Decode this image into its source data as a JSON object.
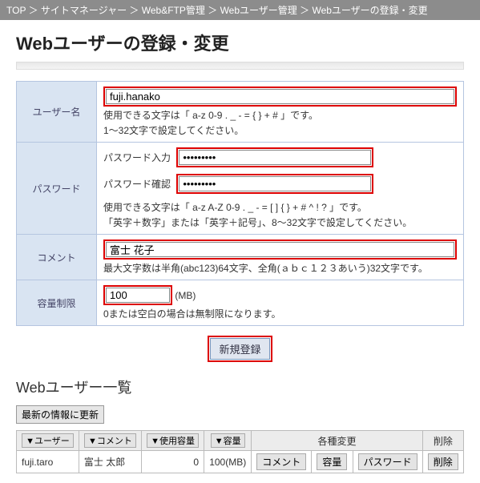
{
  "breadcrumb": {
    "items": [
      "TOP",
      "サイトマネージャー",
      "Web&FTP管理",
      "Webユーザー管理",
      "Webユーザーの登録・変更"
    ],
    "sep": " ＞ "
  },
  "heading": "Webユーザーの登録・変更",
  "form": {
    "username": {
      "label": "ユーザー名",
      "value": "fuji.hanako",
      "hint1": "使用できる文字は「 a-z 0-9 . _ - = { } + # 」です。",
      "hint2": "1～32文字で設定してください。"
    },
    "password": {
      "label": "パスワード",
      "pw_label": "パスワード入力",
      "pw_value": "●●●●●●●●●",
      "pwc_label": "パスワード確認",
      "pwc_value": "●●●●●●●●●",
      "hint1": "使用できる文字は「 a-z A-Z 0-9 . _ - = [ ] { } + # ^ ! ? 」です。",
      "hint2": "「英字＋数字」または「英字＋記号」、8～32文字で設定してください。"
    },
    "comment": {
      "label": "コメント",
      "value": "富士 花子",
      "hint": "最大文字数は半角(abc123)64文字、全角(ａｂｃ１２３あいう)32文字です。"
    },
    "limit": {
      "label": "容量制限",
      "value": "100",
      "unit": "(MB)",
      "hint": "0または空白の場合は無制限になります。"
    },
    "submit": "新規登録"
  },
  "list": {
    "heading": "Webユーザー一覧",
    "refresh": "最新の情報に更新",
    "headers": {
      "user": "▼ユーザー",
      "comment": "▼コメント",
      "used": "▼使用容量",
      "cap": "▼容量",
      "changes": "各種変更",
      "delete": "削除"
    },
    "row": {
      "user": "fuji.taro",
      "comment": "富士 太郎",
      "used": "0",
      "cap": "100(MB)",
      "btn_comment": "コメント",
      "btn_cap": "容量",
      "btn_pw": "パスワード",
      "btn_del": "削除"
    }
  }
}
